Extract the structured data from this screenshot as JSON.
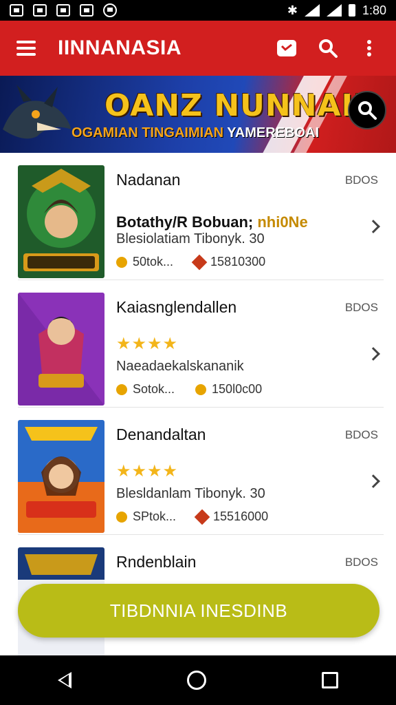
{
  "status_bar": {
    "time": "1:80"
  },
  "app_bar": {
    "title": "IINNANASIA"
  },
  "banner": {
    "title": "OANZ NUNNAIN",
    "subtitle_main": "OGAMIAN TINGAIMIAN",
    "subtitle_tail": "YAMEREBOAI"
  },
  "items": [
    {
      "title": "Nadanan",
      "tag": "BDOS",
      "line2": "Botathy/R Bobuan;",
      "line2_highlight": "nhi0Ne",
      "desc": "Blesiolatiam Tibonyk. 30",
      "stat1": "50tok...",
      "stat2": "15810300",
      "stars": ""
    },
    {
      "title": "Kaiasnglendallen",
      "tag": "BDOS",
      "line2": "",
      "line2_highlight": "",
      "desc": "Naeadaekalskananik",
      "stat1": "Sotok...",
      "stat2": "150l0c00",
      "stars": "★★★★",
      "star_rating": 4
    },
    {
      "title": "Denandaltan",
      "tag": "BDOS",
      "line2": "",
      "line2_highlight": "",
      "desc": "Blesldanlam Tibonyk. 30",
      "stat1": "SPtok...",
      "stat2": "15516000",
      "stars": "★★★★",
      "star_rating": 4
    },
    {
      "title": "Rndenblain",
      "tag": "BDOS",
      "desc": "",
      "stat1": "",
      "stat2": "",
      "stars": ""
    }
  ],
  "cta": {
    "label": "TIBDNNIA INESDINB"
  },
  "colors": {
    "brand_red": "#d21f1f",
    "cta_green": "#b9bc17",
    "star": "#f3b51a"
  }
}
